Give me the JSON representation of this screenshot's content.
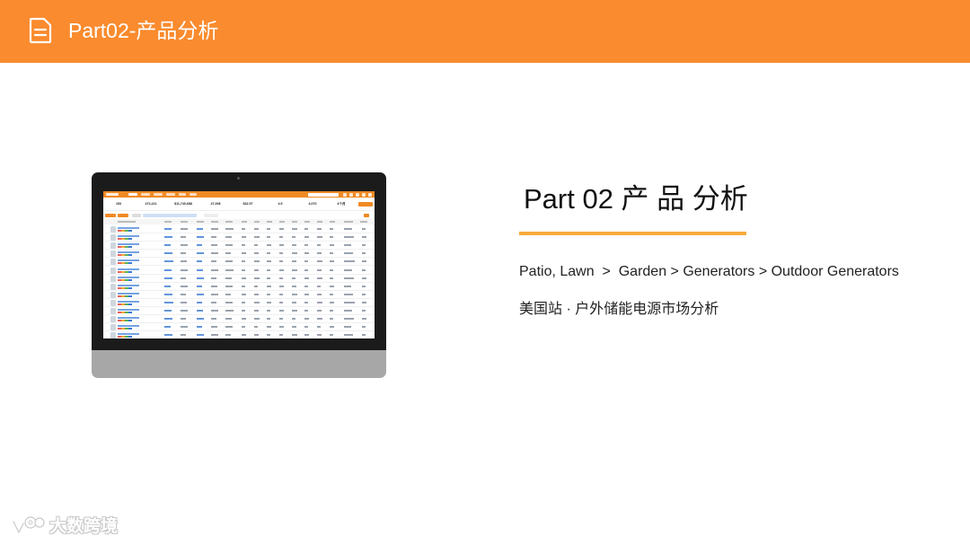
{
  "banner": {
    "title": "Part02-产品分析",
    "icon": "document-icon",
    "color": "#fa8b2e"
  },
  "mockup": {
    "screen_stats": [
      "153",
      "472,221",
      "$11,740,688",
      "47,008",
      "$32.57",
      "4.5",
      "3,070",
      "4个月"
    ],
    "accent": "#f08a24"
  },
  "main": {
    "heading": "Part 02  产 品 分析",
    "breadcrumb": "Patio, Lawn  >  Garden > Generators > Outdoor Generators",
    "subtitle": "美国站 · 户外储能电源市场分析",
    "underline_color": "#f7ab3c"
  },
  "watermark": {
    "text": "大数跨境",
    "icon": "brand-logo-icon"
  }
}
